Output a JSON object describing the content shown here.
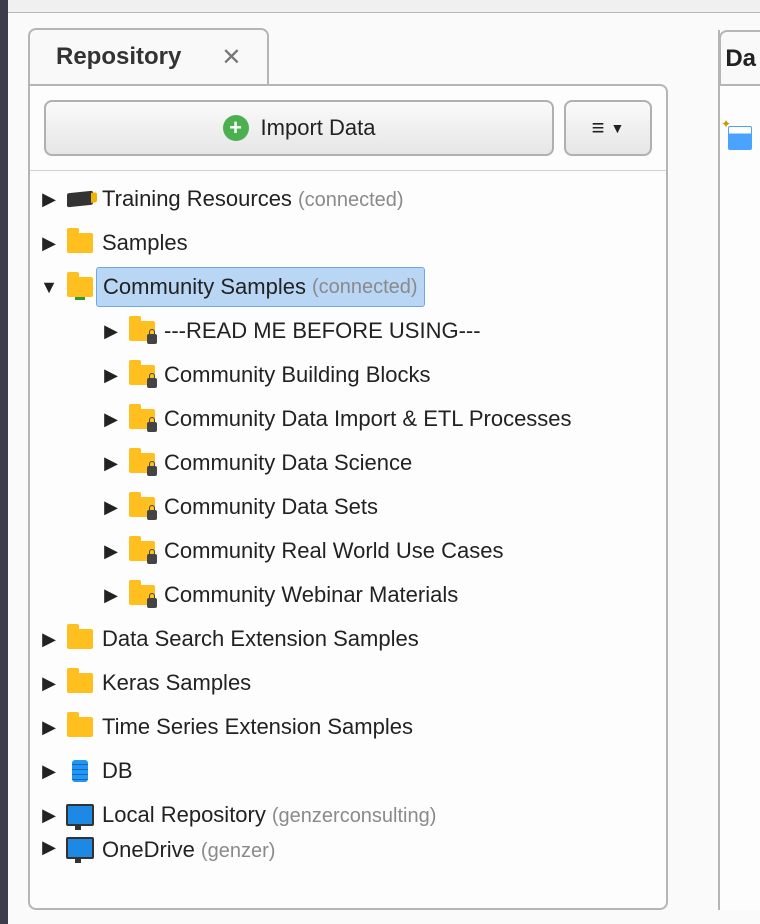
{
  "panel": {
    "title": "Repository",
    "import_label": "Import Data"
  },
  "right_panel": {
    "title_clip": "Da"
  },
  "tree": [
    {
      "level": 0,
      "expanded": false,
      "icon": "hat",
      "label": "Training Resources",
      "suffix": "(connected)"
    },
    {
      "level": 0,
      "expanded": false,
      "icon": "folder",
      "label": "Samples"
    },
    {
      "level": 0,
      "expanded": true,
      "icon": "folder-net",
      "label": "Community Samples",
      "suffix": "(connected)",
      "selected": true
    },
    {
      "level": 1,
      "expanded": false,
      "icon": "folder-lock",
      "label": "---READ ME BEFORE USING---"
    },
    {
      "level": 1,
      "expanded": false,
      "icon": "folder-lock",
      "label": "Community Building Blocks"
    },
    {
      "level": 1,
      "expanded": false,
      "icon": "folder-lock",
      "label": "Community Data Import & ETL Processes"
    },
    {
      "level": 1,
      "expanded": false,
      "icon": "folder-lock",
      "label": "Community Data Science"
    },
    {
      "level": 1,
      "expanded": false,
      "icon": "folder-lock",
      "label": "Community Data Sets"
    },
    {
      "level": 1,
      "expanded": false,
      "icon": "folder-lock",
      "label": "Community Real World Use Cases"
    },
    {
      "level": 1,
      "expanded": false,
      "icon": "folder-lock",
      "label": "Community Webinar Materials"
    },
    {
      "level": 0,
      "expanded": false,
      "icon": "folder",
      "label": "Data Search Extension Samples"
    },
    {
      "level": 0,
      "expanded": false,
      "icon": "folder",
      "label": "Keras Samples"
    },
    {
      "level": 0,
      "expanded": false,
      "icon": "folder",
      "label": "Time Series Extension Samples"
    },
    {
      "level": 0,
      "expanded": false,
      "icon": "db",
      "label": "DB"
    },
    {
      "level": 0,
      "expanded": false,
      "icon": "monitor",
      "label": "Local Repository",
      "suffix": "(genzerconsulting)"
    },
    {
      "level": 0,
      "expanded": false,
      "icon": "monitor",
      "label": "OneDrive",
      "suffix": "(genzer)",
      "clipped": true
    }
  ]
}
